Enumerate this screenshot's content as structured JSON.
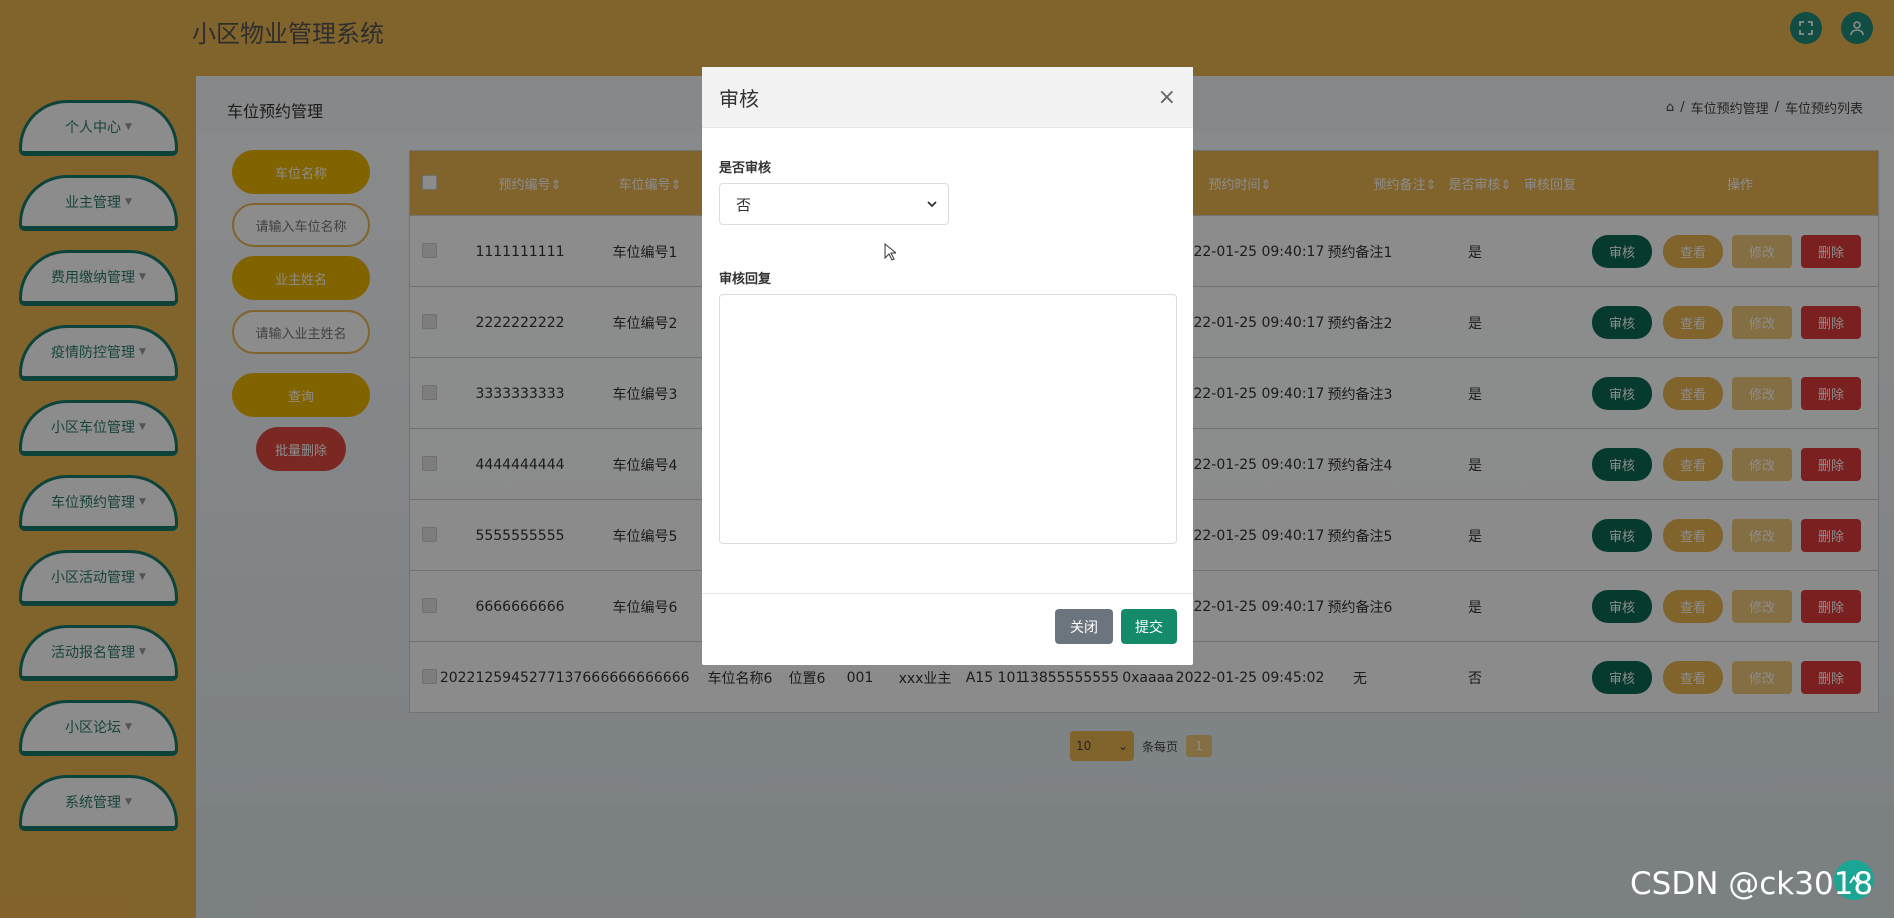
{
  "header": {
    "app_title": "小区物业管理系统"
  },
  "sidebar": {
    "items": [
      {
        "label": "个人中心"
      },
      {
        "label": "业主管理"
      },
      {
        "label": "费用缴纳管理"
      },
      {
        "label": "疫情防控管理"
      },
      {
        "label": "小区车位管理"
      },
      {
        "label": "车位预约管理"
      },
      {
        "label": "小区活动管理"
      },
      {
        "label": "活动报名管理"
      },
      {
        "label": "小区论坛"
      },
      {
        "label": "系统管理"
      }
    ],
    "caret": "▼"
  },
  "page": {
    "title": "车位预约管理",
    "breadcrumb": [
      "⌂",
      "/",
      "车位预约管理",
      "/",
      "车位预约列表"
    ]
  },
  "search": {
    "field1_label": "车位名称",
    "field1_placeholder": "请输入车位名称",
    "field2_label": "业主姓名",
    "field2_placeholder": "请输入业主姓名",
    "query_label": "查询",
    "bulk_delete_label": "批量删除"
  },
  "table": {
    "headers": [
      "预约编号⇕",
      "车位编号⇕",
      "",
      "",
      "",
      "",
      "",
      "",
      "预约时间⇕",
      "预约备注⇕",
      "是否审核⇕",
      "审核回复",
      "操作"
    ],
    "rows": [
      {
        "id": "1111111111",
        "code": "车位编号1",
        "name": "",
        "pos": "",
        "num": "",
        "owner": "",
        "room": "",
        "phone": "",
        "remark_tail": "1",
        "time": "2022-01-25 09:40:17",
        "note": "预约备注1",
        "audited": "是"
      },
      {
        "id": "2222222222",
        "code": "车位编号2",
        "name": "",
        "pos": "",
        "num": "",
        "owner": "",
        "room": "",
        "phone": "",
        "remark_tail": "2",
        "time": "2022-01-25 09:40:17",
        "note": "预约备注2",
        "audited": "是"
      },
      {
        "id": "3333333333",
        "code": "车位编号3",
        "name": "",
        "pos": "",
        "num": "",
        "owner": "",
        "room": "",
        "phone": "",
        "remark_tail": "3",
        "time": "2022-01-25 09:40:17",
        "note": "预约备注3",
        "audited": "是"
      },
      {
        "id": "4444444444",
        "code": "车位编号4",
        "name": "",
        "pos": "",
        "num": "",
        "owner": "",
        "room": "",
        "phone": "",
        "remark_tail": "4",
        "time": "2022-01-25 09:40:17",
        "note": "预约备注4",
        "audited": "是"
      },
      {
        "id": "5555555555",
        "code": "车位编号5",
        "name": "",
        "pos": "",
        "num": "",
        "owner": "",
        "room": "",
        "phone": "",
        "remark_tail": "5",
        "time": "2022-01-25 09:40:17",
        "note": "预约备注5",
        "audited": "是"
      },
      {
        "id": "6666666666",
        "code": "车位编号6",
        "name": "",
        "pos": "",
        "num": "",
        "owner": "",
        "room": "",
        "phone": "",
        "remark_tail": "6",
        "time": "2022-01-25 09:40:17",
        "note": "预约备注6",
        "audited": "是"
      },
      {
        "id": "202212594527713766",
        "code": "6666666666",
        "name": "车位名称6",
        "pos": "位置6",
        "num": "001",
        "owner": "xxx业主",
        "room": "A15 101",
        "phone": "13855555555",
        "remark_tail": "0xaaaa",
        "time": "2022-01-25 09:45:02",
        "note": "无",
        "audited": "否"
      }
    ],
    "actions": {
      "audit": "审核",
      "view": "查看",
      "edit": "修改",
      "delete": "删除"
    }
  },
  "pager": {
    "page_size": "10",
    "per_page_label": "条每页",
    "current_page": "1"
  },
  "modal": {
    "title": "审核",
    "close_glyph": "×",
    "audit_label": "是否审核",
    "audit_value": "否",
    "reply_label": "审核回复",
    "close_btn": "关闭",
    "submit_btn": "提交"
  },
  "watermark": "CSDN @ck3018"
}
